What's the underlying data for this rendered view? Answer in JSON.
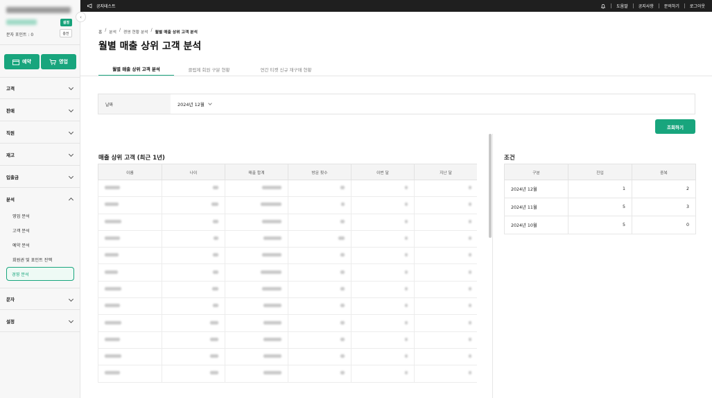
{
  "sidebar": {
    "settings_badge": "설정",
    "points_label": "문자 포인트 : 0",
    "charge_button": "충전",
    "reservation_button": "예약",
    "sales_button": "영업",
    "categories": [
      {
        "label": "고객"
      },
      {
        "label": "판매"
      },
      {
        "label": "직원"
      },
      {
        "label": "재고"
      },
      {
        "label": "입출금"
      },
      {
        "label": "분석"
      },
      {
        "label": "문자"
      },
      {
        "label": "설정"
      }
    ],
    "analysis_items": [
      "영업 분석",
      "고객 분석",
      "예약 분석",
      "회원권 및 포인트 잔액",
      "경영 분석"
    ],
    "accent_color": "#18a57d"
  },
  "topbar": {
    "notice": "공지테스트",
    "links": [
      "도움말",
      "공지사항",
      "문의하기",
      "로그아웃"
    ]
  },
  "breadcrumb": [
    "홈",
    "분석",
    "경영 현황 분석",
    "월별 매출 상위 고객 분석"
  ],
  "page_title": "월별 매출 상위 고객 분석",
  "tabs": [
    "월별 매출 상위 고객 분석",
    "클럽제 회원 구분 현황",
    "연간 티켓 신규 재구매 현황"
  ],
  "filter": {
    "label": "날짜",
    "value": "2024년 12월"
  },
  "search_button": "조회하기",
  "left_table": {
    "title": "매출 상위 고객 (최근 1년)",
    "columns": [
      "이름",
      "나이",
      "매출 합계",
      "방문 횟수",
      "이번 달",
      "지난 달"
    ]
  },
  "right_table": {
    "title": "조건",
    "columns": [
      "구분",
      "진입",
      "중복"
    ],
    "rows": [
      {
        "period": "2024년 12월",
        "entry": "1",
        "dup": "2"
      },
      {
        "period": "2024년 11월",
        "entry": "5",
        "dup": "3"
      },
      {
        "period": "2024년 10월",
        "entry": "5",
        "dup": "0"
      }
    ]
  }
}
